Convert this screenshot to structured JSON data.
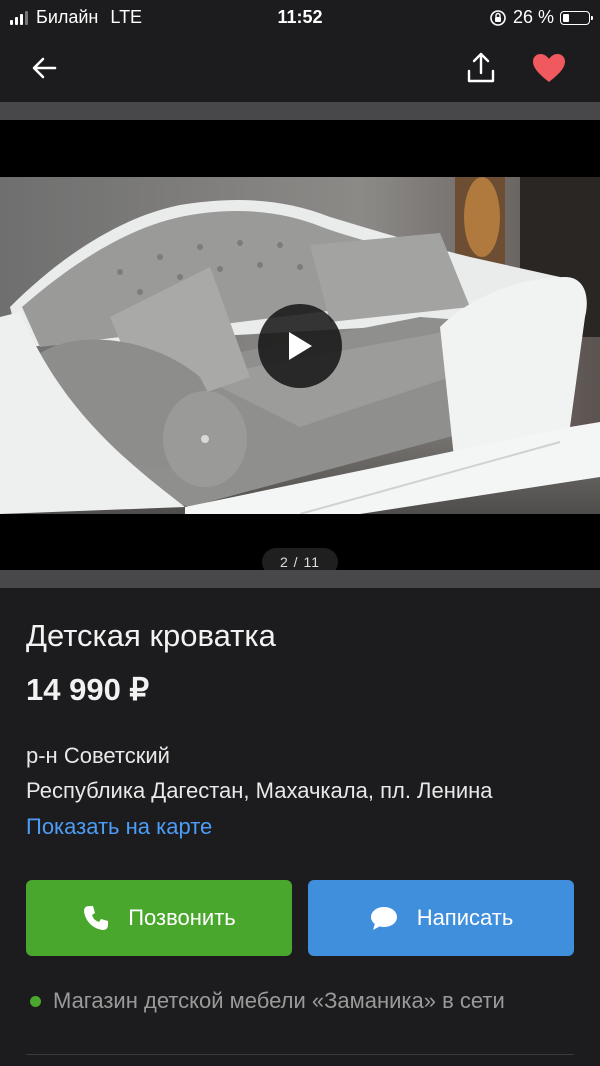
{
  "status": {
    "carrier": "Билайн",
    "network": "LTE",
    "time": "11:52",
    "battery_text": "26 %",
    "battery_level": 0.26
  },
  "nav": {
    "back_icon": "arrow-left-icon",
    "share_icon": "share-icon",
    "favorite_icon": "heart-icon",
    "favorite_color": "#f0595e"
  },
  "gallery": {
    "counter": "2 / 11",
    "play_icon": "play-icon"
  },
  "listing": {
    "title": "Детская кроватка",
    "price": "14 990 ₽",
    "district": "р-н Советский",
    "address": "Республика Дагестан, Махачкала, пл. Ленина",
    "map_link": "Показать на карте"
  },
  "actions": {
    "call_label": "Позвонить",
    "call_color": "#4aa72d",
    "message_label": "Написать",
    "message_color": "#3f8fdc"
  },
  "seller": {
    "text": "Магазин детской мебели «Заманика» в сети",
    "online_color": "#4aa72d"
  }
}
